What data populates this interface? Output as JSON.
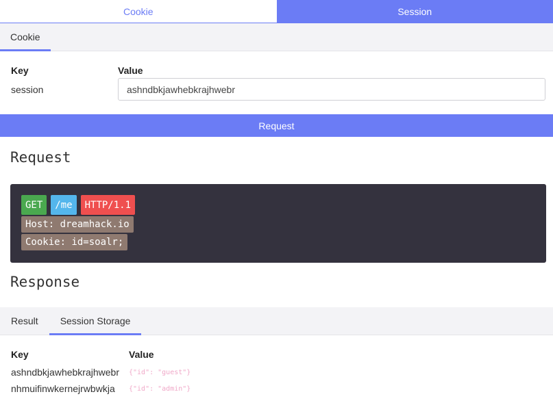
{
  "top_tabs": [
    {
      "label": "Cookie",
      "active": false
    },
    {
      "label": "Session",
      "active": true
    }
  ],
  "cookie_tab": {
    "label": "Cookie"
  },
  "cookie_form": {
    "key_header": "Key",
    "value_header": "Value",
    "key": "session",
    "value": "ashndbkjawhebkrajhwebr"
  },
  "request_button": {
    "label": "Request"
  },
  "request_section": {
    "title": "Request",
    "method": "GET",
    "path": "/me",
    "protocol": "HTTP/1.1",
    "host_header": "Host: dreamhack.io",
    "cookie_header": "Cookie: id=soalr;"
  },
  "response_section": {
    "title": "Response"
  },
  "result_tabs": [
    {
      "label": "Result",
      "active": false
    },
    {
      "label": "Session Storage",
      "active": true
    }
  ],
  "session_storage": {
    "key_header": "Key",
    "value_header": "Value",
    "rows": [
      {
        "key": "ashndbkjawhebkrajhwebr",
        "value": "{\"id\": \"guest\"}"
      },
      {
        "key": "nhmuifinwkernejrwbwkja",
        "value": "{\"id\": \"admin\"}"
      }
    ]
  },
  "colors": {
    "accent": "#6b7cf5",
    "code_bg": "#34323e",
    "get": "#4aa84f",
    "path": "#54b6ec",
    "protocol": "#ef4f4f",
    "header": "#8f7a70"
  }
}
